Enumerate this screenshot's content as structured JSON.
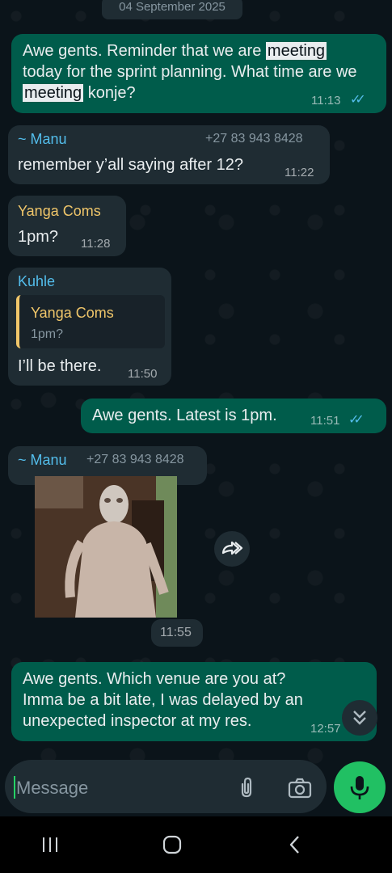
{
  "date_label": "04 September 2025",
  "messages": [
    {
      "text_parts": [
        "Awe gents. Reminder that we are ",
        "meeting",
        " today for the sprint planning. What time are we ",
        "meeting",
        " konje?"
      ],
      "time": "11:13"
    },
    {
      "sender": "~ Manu",
      "phone": "+27 83 943 8428",
      "text": "remember y’all saying after 12?",
      "time": "11:22"
    },
    {
      "sender": "Yanga Coms",
      "text": "1pm?",
      "time": "11:28"
    },
    {
      "sender": "Kuhle",
      "quote": {
        "sender": "Yanga Coms",
        "text": "1pm?"
      },
      "text": "I’ll be there.",
      "time": "11:50"
    },
    {
      "text": "Awe gents. Latest is 1pm.",
      "time": "11:51"
    },
    {
      "sender": "~ Manu",
      "phone": "+27 83 943 8428",
      "time": "11:55"
    },
    {
      "text_lines": [
        "Awe gents. Which venue are you at?",
        "Imma be a bit late, I was delayed by an",
        "unexpected inspector at my res."
      ],
      "time": "12:57"
    }
  ],
  "composer": {
    "placeholder": "Message"
  },
  "icons": {
    "read_receipt": "double-check-icon",
    "forward": "forward-icon",
    "scroll_down": "chevron-double-down-icon",
    "attach": "paperclip-icon",
    "camera": "camera-icon",
    "mic": "microphone-icon",
    "nav_recents": "recents-icon",
    "nav_home": "home-icon",
    "nav_back": "back-icon"
  },
  "colors": {
    "outgoing_bubble": "#005c4b",
    "incoming_bubble": "#1f2c33",
    "accent_green": "#21c063",
    "read_tick_blue": "#53bdeb",
    "sender_manu": "#53bdeb",
    "sender_yanga": "#f0c66a",
    "sender_kuhle": "#53bdeb"
  }
}
